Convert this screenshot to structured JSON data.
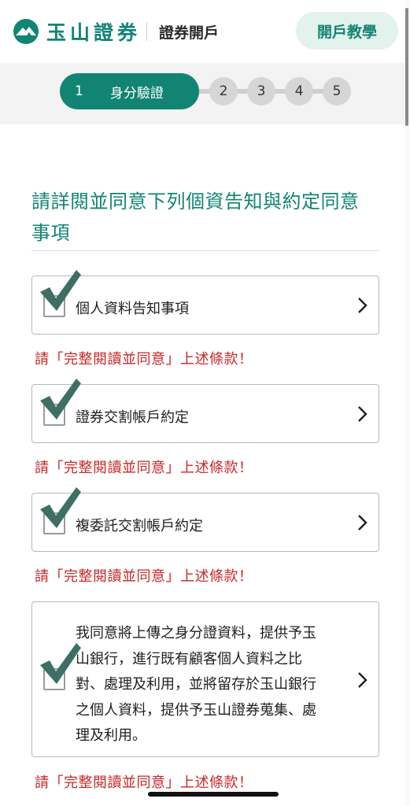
{
  "header": {
    "brand": "玉山證券",
    "title": "證券開戶",
    "tutorial_label": "開戶教學"
  },
  "steps": {
    "active": {
      "number": "1",
      "label": "身分驗證"
    },
    "others": [
      "2",
      "3",
      "4",
      "5"
    ]
  },
  "section": {
    "title_line1": "請詳閱並同意下列個資告知與約定同意",
    "title_line2": "事項"
  },
  "agreements": [
    {
      "label": "個人資料告知事項",
      "checked": true
    },
    {
      "label": "證券交割帳戶約定",
      "checked": true
    },
    {
      "label": "複委託交割帳戶約定",
      "checked": true
    }
  ],
  "consent": {
    "lines": [
      "我同意將上傳之身分證資料，提供予玉",
      "山銀行，進行既有顧客個人資料之比",
      "對、處理及利用，並將留存於玉山銀行",
      "之個人資料，提供予玉山證券蒐集、處",
      "理及利用。"
    ],
    "checked": true
  },
  "warning_text": "請「完整閱讀並同意」上述條款！",
  "colors": {
    "brand": "#128474",
    "brand_light": "#e2f2ec",
    "warning": "#c62828",
    "checkmark": "#3f6f64"
  },
  "icons": {
    "logo": "yushan-mountain-logo-icon",
    "chevron": "chevron-right-icon",
    "check": "checkmark-icon"
  }
}
